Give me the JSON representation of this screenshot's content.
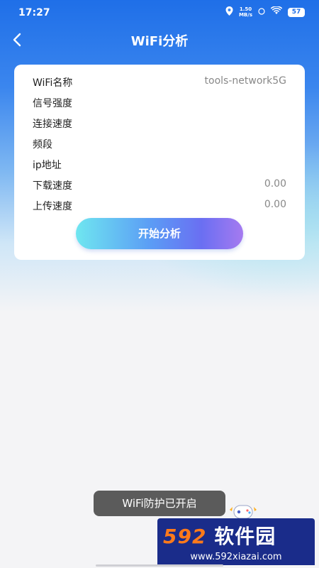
{
  "status_bar": {
    "time": "17:27",
    "speed_value": "1.50",
    "speed_unit": "MB/s",
    "battery": "57"
  },
  "nav": {
    "title": "WiFi分析"
  },
  "info": {
    "rows": [
      {
        "label": "WiFi名称",
        "value": "tools-network5G"
      },
      {
        "label": "信号强度",
        "value": ""
      },
      {
        "label": "连接速度",
        "value": ""
      },
      {
        "label": "频段",
        "value": ""
      },
      {
        "label": "ip地址",
        "value": ""
      },
      {
        "label": "下载速度",
        "value": "0.00"
      },
      {
        "label": "上传速度",
        "value": "0.00"
      }
    ]
  },
  "actions": {
    "start_label": "开始分析"
  },
  "toast": {
    "text": "WiFi防护已开启"
  },
  "watermark": {
    "number": "592",
    "brand": "软件园",
    "url": "www.592xiazai.com"
  },
  "colors": {
    "primary_blue": "#1f6fe8",
    "card_bg": "#ffffff",
    "page_bg": "#f4f4f6"
  }
}
